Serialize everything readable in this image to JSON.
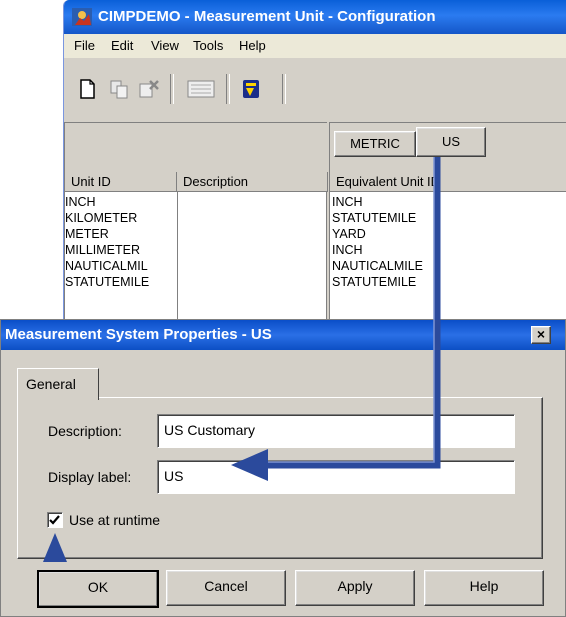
{
  "main_window": {
    "title": "CIMPDEMO - Measurement Unit - Configuration",
    "menu": [
      "File",
      "Edit",
      "View",
      "Tools",
      "Help"
    ],
    "toolbar_icons": [
      "new-document-icon",
      "copy-icon",
      "delete-icon",
      "properties-icon",
      "measurement-icon"
    ]
  },
  "unit_table": {
    "columns": [
      "Unit ID",
      "Description"
    ],
    "rows": [
      "INCH",
      "KILOMETER",
      "METER",
      "MILLIMETER",
      "NAUTICALMIL",
      "STATUTEMILE"
    ]
  },
  "system_tabs": [
    "METRIC",
    "US"
  ],
  "equivalent_table": {
    "column": "Equivalent Unit ID",
    "rows": [
      "INCH",
      "STATUTEMILE",
      "YARD",
      "INCH",
      "NAUTICALMILE",
      "STATUTEMILE"
    ]
  },
  "dialog": {
    "title": "Measurement System Properties - US",
    "close": "×",
    "tab": "General",
    "description_label": "Description:",
    "description_value": "US Customary",
    "display_label_label": "Display label:",
    "display_label_value": "US",
    "use_at_runtime_label": "Use at runtime",
    "use_at_runtime_checked": true,
    "buttons": {
      "ok": "OK",
      "cancel": "Cancel",
      "apply": "Apply",
      "help": "Help"
    }
  },
  "colors": {
    "title_blue": "#0a5fd8",
    "annotation_arrow": "#2b4a9c"
  }
}
